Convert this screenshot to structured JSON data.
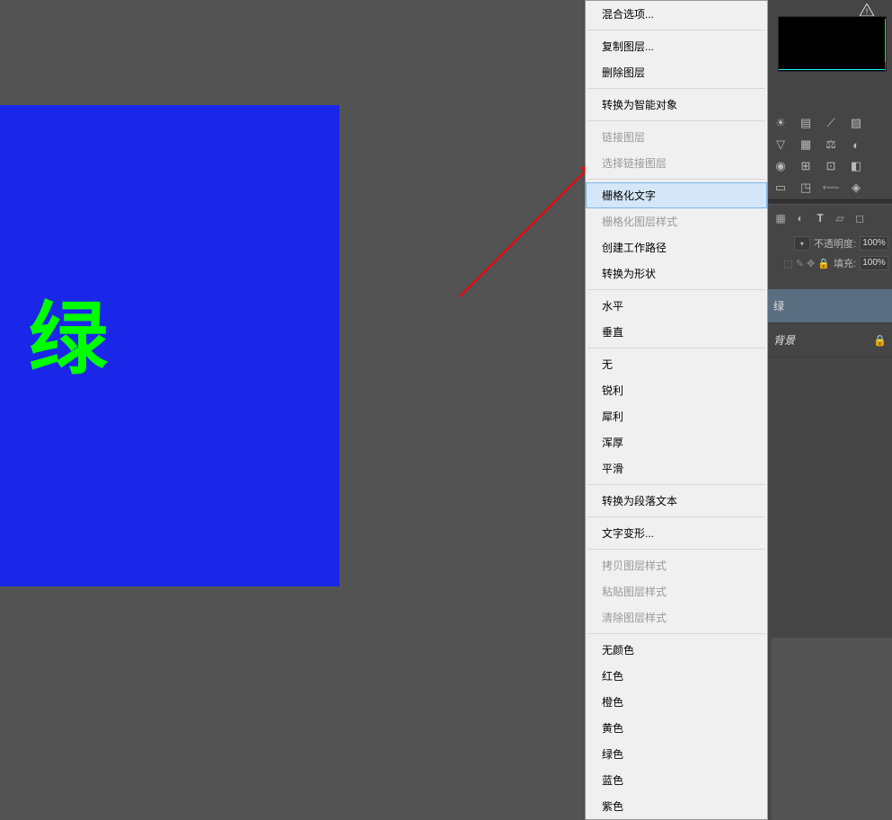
{
  "canvas": {
    "text": "绿"
  },
  "context_menu": {
    "items": [
      {
        "label": "混合选项...",
        "enabled": true,
        "sep_after": true
      },
      {
        "label": "复制图层...",
        "enabled": true
      },
      {
        "label": "删除图层",
        "enabled": true,
        "sep_after": true
      },
      {
        "label": "转换为智能对象",
        "enabled": true,
        "sep_after": true
      },
      {
        "label": "链接图层",
        "enabled": false
      },
      {
        "label": "选择链接图层",
        "enabled": false,
        "sep_after": true
      },
      {
        "label": "栅格化文字",
        "enabled": true,
        "highlighted": true
      },
      {
        "label": "栅格化图层样式",
        "enabled": false
      },
      {
        "label": "创建工作路径",
        "enabled": true
      },
      {
        "label": "转换为形状",
        "enabled": true,
        "sep_after": true
      },
      {
        "label": "水平",
        "enabled": true
      },
      {
        "label": "垂直",
        "enabled": true,
        "sep_after": true
      },
      {
        "label": "无",
        "enabled": true
      },
      {
        "label": "锐利",
        "enabled": true
      },
      {
        "label": "犀利",
        "enabled": true
      },
      {
        "label": "浑厚",
        "enabled": true
      },
      {
        "label": "平滑",
        "enabled": true,
        "sep_after": true
      },
      {
        "label": "转换为段落文本",
        "enabled": true,
        "sep_after": true
      },
      {
        "label": "文字变形...",
        "enabled": true,
        "sep_after": true
      },
      {
        "label": "拷贝图层样式",
        "enabled": false
      },
      {
        "label": "粘贴图层样式",
        "enabled": false
      },
      {
        "label": "清除图层样式",
        "enabled": false,
        "sep_after": true
      },
      {
        "label": "无颜色",
        "enabled": true
      },
      {
        "label": "红色",
        "enabled": true
      },
      {
        "label": "橙色",
        "enabled": true
      },
      {
        "label": "黄色",
        "enabled": true
      },
      {
        "label": "绿色",
        "enabled": true
      },
      {
        "label": "蓝色",
        "enabled": true
      },
      {
        "label": "紫色",
        "enabled": true
      }
    ]
  },
  "layers_panel": {
    "opacity_label": "不透明度:",
    "opacity_value": "100%",
    "fill_label": "填充:",
    "fill_value": "100%",
    "layers": [
      {
        "name": "绿",
        "selected": true,
        "locked": false
      },
      {
        "name": "背景",
        "selected": false,
        "locked": true
      }
    ]
  }
}
